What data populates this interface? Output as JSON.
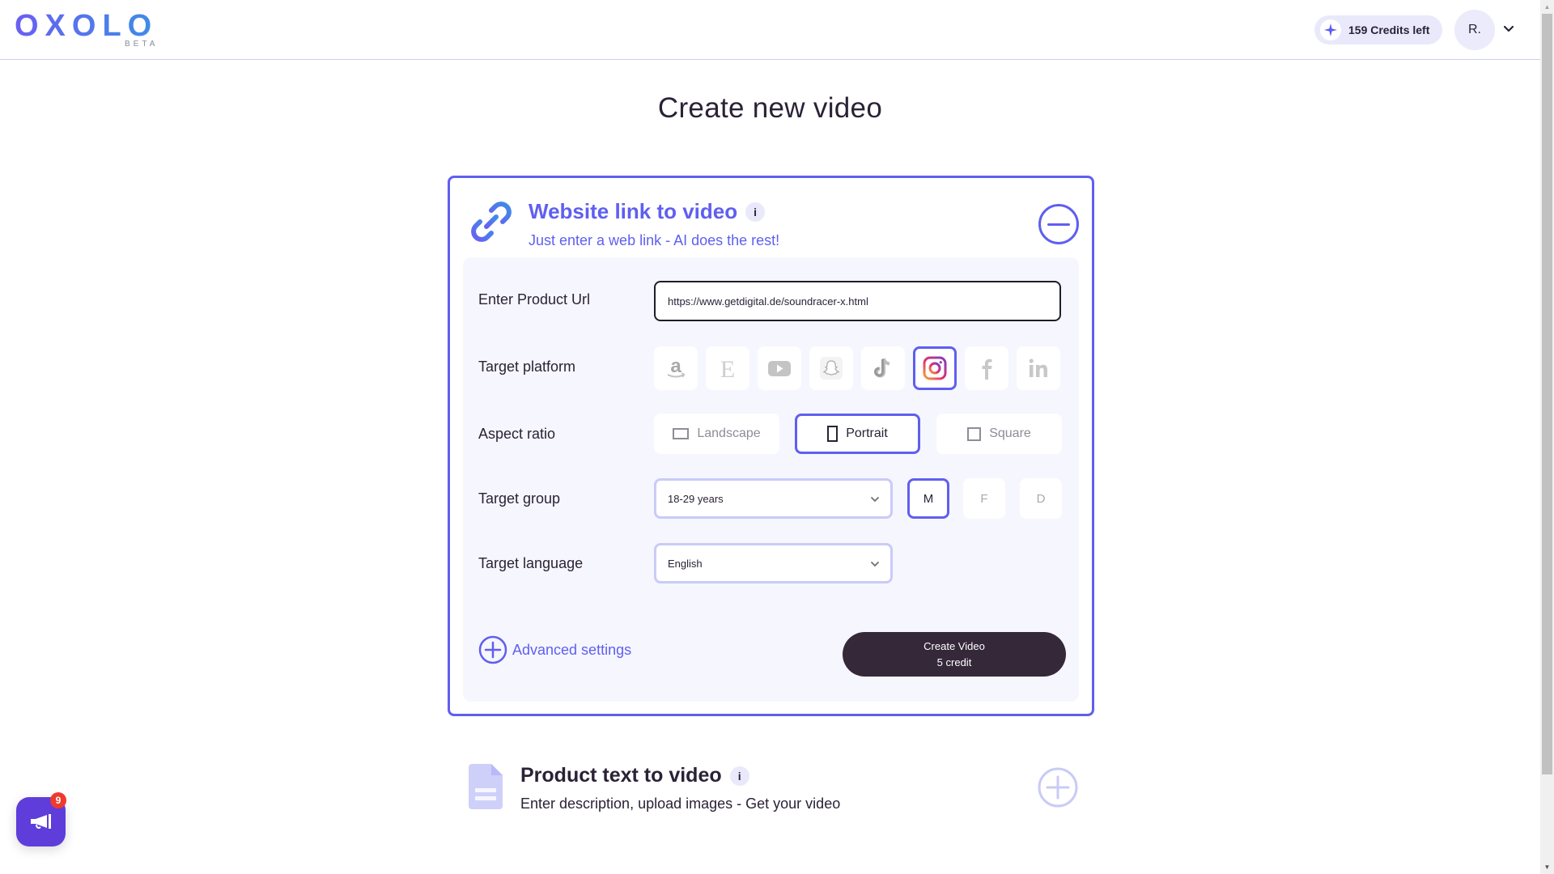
{
  "header": {
    "logo_text": "OXOLO",
    "logo_badge": "BETA",
    "credits_label": "159 Credits left",
    "credits_icon": "sparkle-icon",
    "avatar_initials": "R.",
    "avatar_menu_icon": "chevron-down-icon"
  },
  "page": {
    "title": "Create new video"
  },
  "website_card": {
    "icon": "link-icon",
    "title": "Website link to video",
    "info_label": "i",
    "subtitle": "Just enter a web link - AI does the rest!",
    "collapse_icon": "minus-circle-icon",
    "form": {
      "url_label": "Enter Product Url",
      "url_value": "https://www.getdigital.de/soundracer-x.html",
      "platform_label": "Target platform",
      "platforms": [
        {
          "name": "amazon",
          "icon": "amazon-icon",
          "selected": false
        },
        {
          "name": "etsy",
          "icon": "etsy-icon",
          "selected": false
        },
        {
          "name": "youtube",
          "icon": "youtube-icon",
          "selected": false
        },
        {
          "name": "snapchat",
          "icon": "snapchat-icon",
          "selected": false
        },
        {
          "name": "tiktok",
          "icon": "tiktok-icon",
          "selected": false
        },
        {
          "name": "instagram",
          "icon": "instagram-icon",
          "selected": true
        },
        {
          "name": "facebook",
          "icon": "facebook-icon",
          "selected": false
        },
        {
          "name": "linkedin",
          "icon": "linkedin-icon",
          "selected": false
        }
      ],
      "aspect_label": "Aspect ratio",
      "aspect_options": [
        {
          "label": "Landscape",
          "selected": false
        },
        {
          "label": "Portrait",
          "selected": true
        },
        {
          "label": "Square",
          "selected": false
        }
      ],
      "group_label": "Target group",
      "group_value": "18-29 years",
      "gender_options": [
        {
          "label": "M",
          "selected": true
        },
        {
          "label": "F",
          "selected": false
        },
        {
          "label": "D",
          "selected": false
        }
      ],
      "language_label": "Target language",
      "language_value": "English",
      "advanced_label": "Advanced settings",
      "create_button": {
        "line1": "Create Video",
        "line2": "5 credit"
      }
    }
  },
  "text_card": {
    "icon": "document-icon",
    "title": "Product text to video",
    "info_label": "i",
    "subtitle": "Enter description, upload images - Get your video",
    "expand_icon": "plus-circle-icon"
  },
  "announcements": {
    "icon": "megaphone-icon",
    "badge_count": "9"
  },
  "colors": {
    "accent": "#5f5ff0",
    "dark": "#342839",
    "panel_bg": "#f6f6fe",
    "badge_red": "#ef3a2e",
    "announce_purple": "#5e3ddb"
  }
}
